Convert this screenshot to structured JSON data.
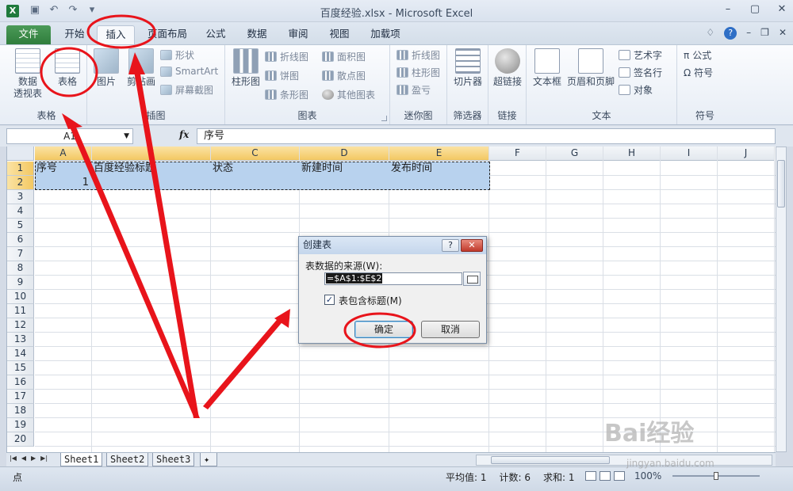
{
  "app": {
    "window_title": "百度经验.xlsx - Microsoft Excel",
    "icon": "X"
  },
  "tabs": [
    "文件",
    "开始",
    "插入",
    "页面布局",
    "公式",
    "数据",
    "审阅",
    "视图",
    "加载项"
  ],
  "ribbon": {
    "tables": {
      "label": "表格",
      "pivot": "数据\n透视表",
      "table": "表格"
    },
    "illustrations": {
      "label": "插图",
      "picture": "图片",
      "clipart": "剪贴画",
      "shapes": "形状",
      "smartart": "SmartArt",
      "screenshot": "屏幕截图"
    },
    "charts": {
      "label": "图表",
      "column": "柱形图",
      "line": "折线图",
      "pie": "饼图",
      "bar": "条形图",
      "area": "面积图",
      "scatter": "散点图",
      "other": "其他图表"
    },
    "sparklines": {
      "label": "迷你图",
      "line": "折线图",
      "column": "柱形图",
      "winloss": "盈亏"
    },
    "filter": {
      "label": "筛选器",
      "slicer": "切片器"
    },
    "links": {
      "label": "链接",
      "hyperlink": "超链接"
    },
    "text": {
      "label": "文本",
      "textbox": "文本框",
      "header": "页眉和页脚",
      "wordart": "艺术字",
      "signature": "签名行",
      "object": "对象"
    },
    "symbols": {
      "label": "符号",
      "equation": "公式",
      "symbol": "符号"
    }
  },
  "formula_bar": {
    "name_box": "A1",
    "fx": "fx",
    "value": "序号"
  },
  "columns": [
    "A",
    "B",
    "C",
    "D",
    "E",
    "F",
    "G",
    "H",
    "I",
    "J"
  ],
  "rows": [
    "1",
    "2",
    "3",
    "4",
    "5",
    "6",
    "7",
    "8",
    "9",
    "10",
    "11",
    "12",
    "13",
    "14",
    "15",
    "16",
    "17",
    "18",
    "19",
    "20"
  ],
  "cells": {
    "A1": "序号",
    "B1": "百度经验标题",
    "C1": "状态",
    "D1": "新建时间",
    "E1": "发布时间",
    "A2": "1"
  },
  "dialog": {
    "title": "创建表",
    "help": "?",
    "close": "✕",
    "source_label": "表数据的来源(W):",
    "source_value": "=$A$1:$E$2",
    "checkbox_checked": true,
    "checkbox_label": "表包含标题(M)",
    "ok": "确定",
    "cancel": "取消"
  },
  "sheets": [
    "Sheet1",
    "Sheet2",
    "Sheet3"
  ],
  "status": {
    "mode": "点",
    "average": "平均值: 1",
    "count": "计数: 6",
    "sum": "求和: 1",
    "zoom": "100%"
  },
  "watermark": {
    "brand": "Bai经验",
    "url": "jingyan.baidu.com"
  },
  "colors": {
    "annotation": "#e8141b",
    "selection": "#b8d2ee",
    "header_selected": "#f3c862",
    "file_tab": "#2f7d3c"
  }
}
